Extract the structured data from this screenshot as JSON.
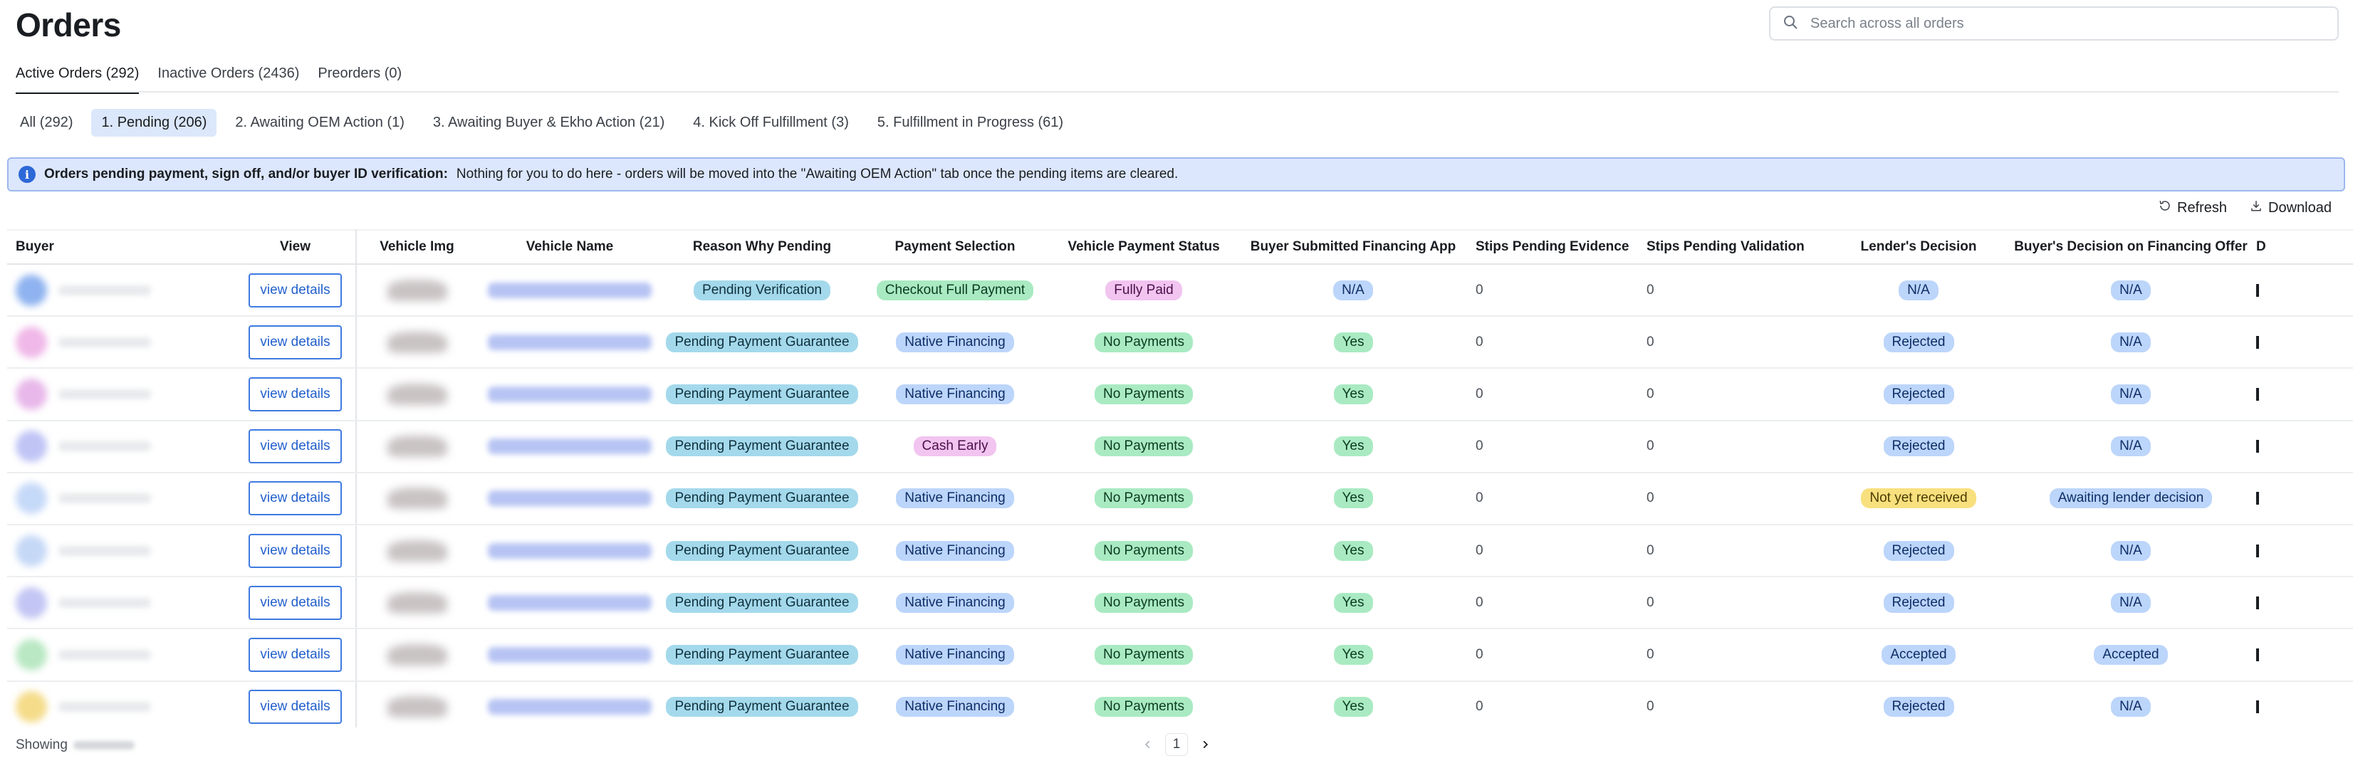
{
  "page_title": "Orders",
  "search": {
    "placeholder": "Search across all orders",
    "value": ""
  },
  "main_tabs": [
    {
      "label": "Active Orders (292)",
      "active": true
    },
    {
      "label": "Inactive Orders (2436)",
      "active": false
    },
    {
      "label": "Preorders (0)",
      "active": false
    }
  ],
  "sub_tabs": [
    {
      "label": "All (292)",
      "active": false
    },
    {
      "label": "1. Pending (206)",
      "active": true
    },
    {
      "label": "2. Awaiting OEM Action (1)",
      "active": false
    },
    {
      "label": "3. Awaiting Buyer & Ekho Action (21)",
      "active": false
    },
    {
      "label": "4. Kick Off Fulfillment (3)",
      "active": false
    },
    {
      "label": "5. Fulfillment in Progress (61)",
      "active": false
    }
  ],
  "banner": {
    "title": "Orders pending payment, sign off, and/or buyer ID verification:",
    "message": "Nothing for you to do here - orders will be moved into the \"Awaiting OEM Action\" tab once the pending items are cleared."
  },
  "toolbar": {
    "refresh_label": "Refresh",
    "download_label": "Download"
  },
  "table": {
    "columns": [
      "Buyer",
      "View",
      "Vehicle Img",
      "Vehicle Name",
      "Reason Why Pending",
      "Payment Selection",
      "Vehicle Payment Status",
      "Buyer Submitted Financing App",
      "Stips Pending Evidence",
      "Stips Pending Validation",
      "Lender's Decision",
      "Buyer's Decision on Financing Offer",
      "D"
    ],
    "view_label": "view details",
    "rows": [
      {
        "reason": "Pending Verification",
        "payment": "Checkout Full Payment",
        "status": "Fully Paid",
        "financing_app": "N/A",
        "stips_evidence": "0",
        "stips_validation": "0",
        "lender": "N/A",
        "buyer_decision": "N/A"
      },
      {
        "reason": "Pending Payment Guarantee",
        "payment": "Native Financing",
        "status": "No Payments",
        "financing_app": "Yes",
        "stips_evidence": "0",
        "stips_validation": "0",
        "lender": "Rejected",
        "buyer_decision": "N/A"
      },
      {
        "reason": "Pending Payment Guarantee",
        "payment": "Native Financing",
        "status": "No Payments",
        "financing_app": "Yes",
        "stips_evidence": "0",
        "stips_validation": "0",
        "lender": "Rejected",
        "buyer_decision": "N/A"
      },
      {
        "reason": "Pending Payment Guarantee",
        "payment": "Cash Early",
        "status": "No Payments",
        "financing_app": "Yes",
        "stips_evidence": "0",
        "stips_validation": "0",
        "lender": "Rejected",
        "buyer_decision": "N/A"
      },
      {
        "reason": "Pending Payment Guarantee",
        "payment": "Native Financing",
        "status": "No Payments",
        "financing_app": "Yes",
        "stips_evidence": "0",
        "stips_validation": "0",
        "lender": "Not yet received",
        "buyer_decision": "Awaiting lender decision"
      },
      {
        "reason": "Pending Payment Guarantee",
        "payment": "Native Financing",
        "status": "No Payments",
        "financing_app": "Yes",
        "stips_evidence": "0",
        "stips_validation": "0",
        "lender": "Rejected",
        "buyer_decision": "N/A"
      },
      {
        "reason": "Pending Payment Guarantee",
        "payment": "Native Financing",
        "status": "No Payments",
        "financing_app": "Yes",
        "stips_evidence": "0",
        "stips_validation": "0",
        "lender": "Rejected",
        "buyer_decision": "N/A"
      },
      {
        "reason": "Pending Payment Guarantee",
        "payment": "Native Financing",
        "status": "No Payments",
        "financing_app": "Yes",
        "stips_evidence": "0",
        "stips_validation": "0",
        "lender": "Accepted",
        "buyer_decision": "Accepted"
      },
      {
        "reason": "Pending Payment Guarantee",
        "payment": "Native Financing",
        "status": "No Payments",
        "financing_app": "Yes",
        "stips_evidence": "0",
        "stips_validation": "0",
        "lender": "Rejected",
        "buyer_decision": "N/A"
      }
    ]
  },
  "footer": {
    "showing_label": "Showing",
    "current_page": "1"
  },
  "colors": {
    "accent": "#2c68d8",
    "banner_bg": "#dce7fd",
    "pill_teal": "#a4d9ec",
    "pill_green": "#a9eac2",
    "pill_pink": "#f2c4f0",
    "pill_blue": "#bcd5fa",
    "pill_yellow": "#f9e07e"
  },
  "icons": [
    "search-icon",
    "info-icon",
    "refresh-icon",
    "download-icon",
    "chevron-left-icon",
    "chevron-right-icon"
  ]
}
